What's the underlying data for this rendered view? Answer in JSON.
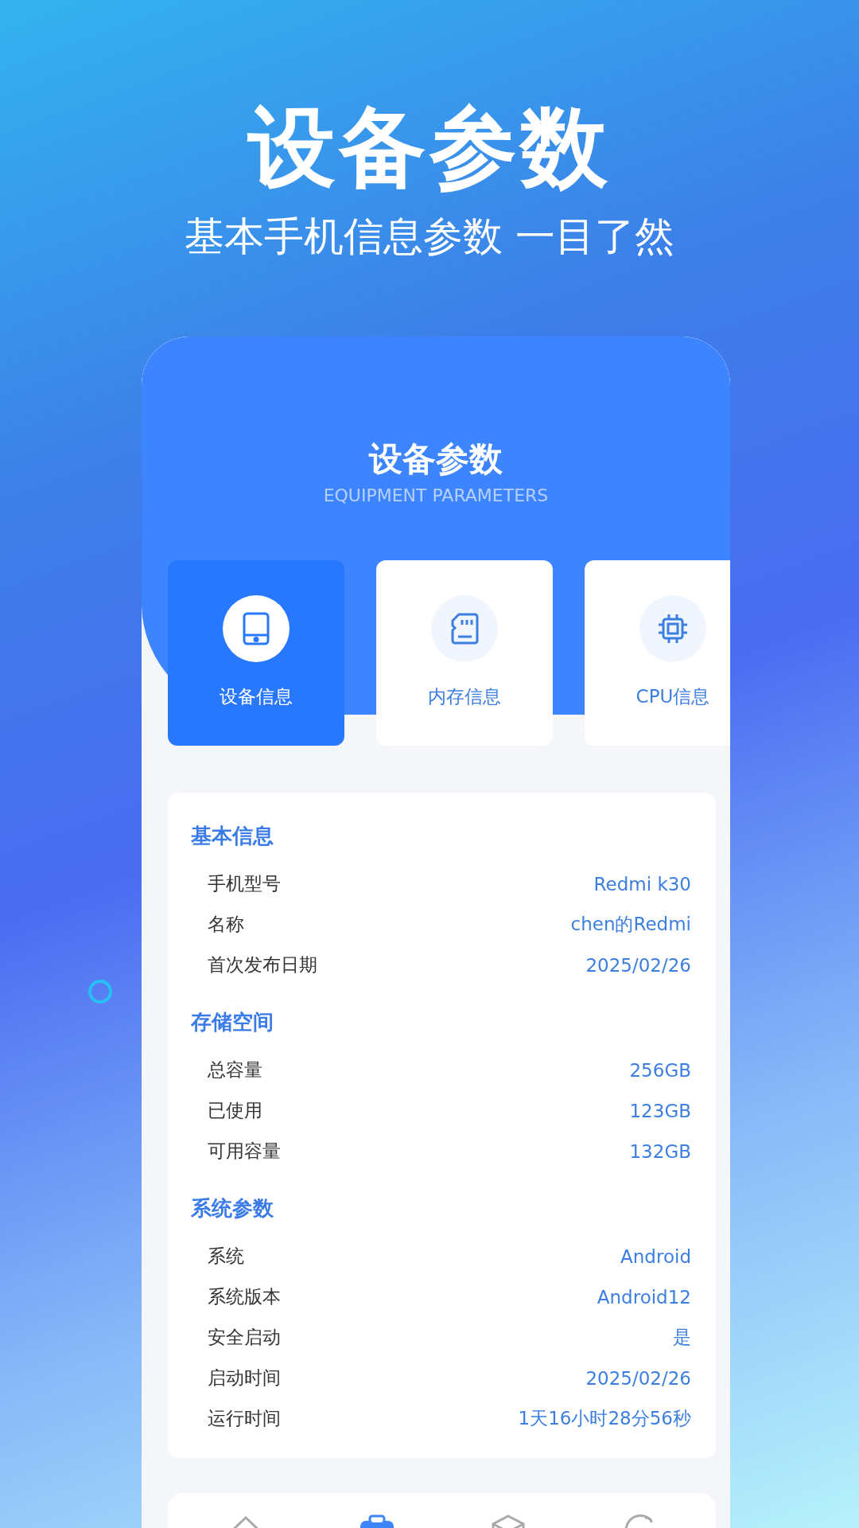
{
  "headline": "设备参数",
  "subheadline": "基本手机信息参数 一目了然",
  "app": {
    "title": "设备参数",
    "subtitle": "EQUIPMENT PARAMETERS",
    "tabs": [
      {
        "label": "设备信息",
        "selected": true
      },
      {
        "label": "内存信息",
        "selected": false
      },
      {
        "label": "CPU信息",
        "selected": false
      }
    ],
    "sections": [
      {
        "title": "基本信息",
        "rows": [
          {
            "label": "手机型号",
            "value": "Redmi k30"
          },
          {
            "label": "名称",
            "value": "chen的Redmi"
          },
          {
            "label": "首次发布日期",
            "value": "2025/02/26"
          }
        ]
      },
      {
        "title": "存储空间",
        "rows": [
          {
            "label": "总容量",
            "value": "256GB"
          },
          {
            "label": "已使用",
            "value": "123GB"
          },
          {
            "label": "可用容量",
            "value": "132GB"
          }
        ]
      },
      {
        "title": "系统参数",
        "rows": [
          {
            "label": "系统",
            "value": "Android"
          },
          {
            "label": "系统版本",
            "value": "Android12"
          },
          {
            "label": "安全启动",
            "value": "是"
          },
          {
            "label": "启动时间",
            "value": "2025/02/26"
          },
          {
            "label": "运行时间",
            "value": "1天16小时28分56秒"
          }
        ]
      }
    ],
    "bottom_nav": [
      {
        "selected": false
      },
      {
        "selected": true
      },
      {
        "selected": false
      },
      {
        "selected": false
      }
    ]
  }
}
